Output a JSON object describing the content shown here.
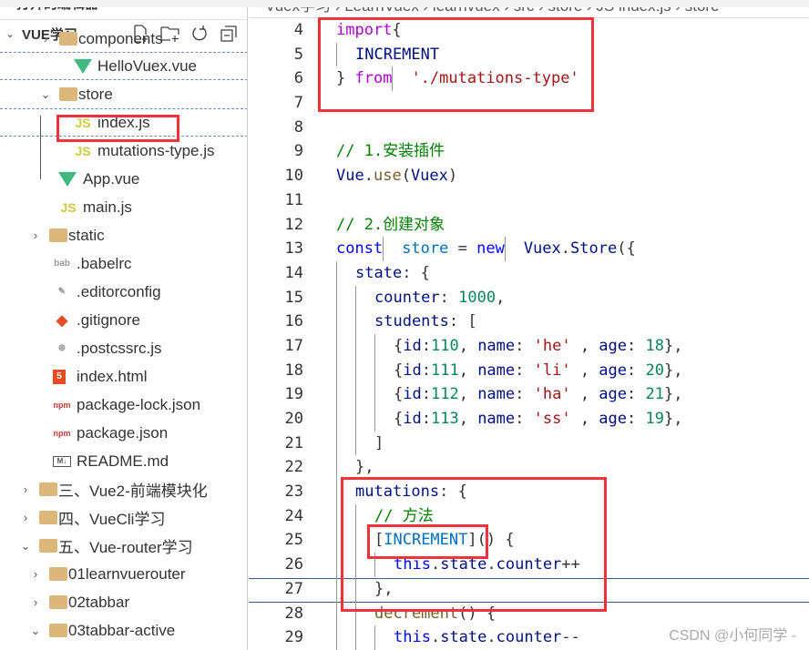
{
  "explorer": {
    "title": "打开的编辑器",
    "section": "VUE学习",
    "actions": [
      "new-file-icon",
      "new-folder-icon",
      "refresh-icon",
      "collapse-all-icon"
    ],
    "items": [
      {
        "label": "components",
        "icon": "folder",
        "depth": 3
      },
      {
        "label": "HelloVuex.vue",
        "icon": "vue",
        "depth": 4
      },
      {
        "label": "store",
        "icon": "folder",
        "depth": 3,
        "expanded": true
      },
      {
        "label": "index.js",
        "icon": "js",
        "depth": 4,
        "selected": true
      },
      {
        "label": "mutations-type.js",
        "icon": "js",
        "depth": 4
      },
      {
        "label": "App.vue",
        "icon": "vue",
        "depth": 3
      },
      {
        "label": "main.js",
        "icon": "js",
        "depth": 3
      },
      {
        "label": "static",
        "icon": "folder",
        "depth": 2,
        "expanded": false
      },
      {
        "label": ".babelrc",
        "icon": "babel",
        "depth": 2
      },
      {
        "label": ".editorconfig",
        "icon": "editorconfig",
        "depth": 2
      },
      {
        "label": ".gitignore",
        "icon": "git",
        "depth": 2
      },
      {
        "label": ".postcssrc.js",
        "icon": "postcss",
        "depth": 2
      },
      {
        "label": "index.html",
        "icon": "html",
        "depth": 2
      },
      {
        "label": "package-lock.json",
        "icon": "npm",
        "depth": 2
      },
      {
        "label": "package.json",
        "icon": "npm",
        "depth": 2
      },
      {
        "label": "README.md",
        "icon": "md",
        "depth": 2
      },
      {
        "label": "三、Vue2-前端模块化",
        "icon": "folder",
        "depth": 1,
        "expanded": false
      },
      {
        "label": "四、VueCli学习",
        "icon": "folder",
        "depth": 1,
        "expanded": false
      },
      {
        "label": "五、Vue-router学习",
        "icon": "folder",
        "depth": 1,
        "expanded": true
      },
      {
        "label": "01learnvuerouter",
        "icon": "folder",
        "depth": 2,
        "expanded": false
      },
      {
        "label": "02tabbar",
        "icon": "folder",
        "depth": 2,
        "expanded": false
      },
      {
        "label": "03tabbar-active",
        "icon": "folder",
        "depth": 2,
        "expanded": true
      }
    ]
  },
  "breadcrumb": "Vuex学习 › LearnVuex › learnvuex › src › store › JS index.js › store",
  "code": [
    {
      "n": 4,
      "t": [
        [
          "import",
          "kw"
        ],
        [
          "{",
          "pn"
        ]
      ]
    },
    {
      "n": 5,
      "t": [
        [
          "  ",
          ""
        ],
        [
          "INCREMENT",
          "id"
        ]
      ]
    },
    {
      "n": 6,
      "t": [
        [
          "} ",
          "pn"
        ],
        [
          "from",
          "kw"
        ],
        [
          " ",
          ""
        ],
        [
          "'./mutations-type'",
          "str"
        ]
      ]
    },
    {
      "n": 7,
      "t": []
    },
    {
      "n": 8,
      "t": []
    },
    {
      "n": 9,
      "t": [
        [
          "// 1.安装插件",
          "cm"
        ]
      ]
    },
    {
      "n": 10,
      "t": [
        [
          "Vue",
          "id"
        ],
        [
          ".",
          "pn"
        ],
        [
          "use",
          "fn"
        ],
        [
          "(",
          "pn"
        ],
        [
          "Vuex",
          "id"
        ],
        [
          ")",
          "pn"
        ]
      ]
    },
    {
      "n": 11,
      "t": []
    },
    {
      "n": 12,
      "t": [
        [
          "// 2.创建对象",
          "cm"
        ]
      ]
    },
    {
      "n": 13,
      "t": [
        [
          "const",
          "bl"
        ],
        [
          " ",
          ""
        ],
        [
          "store",
          "cn"
        ],
        [
          " = ",
          "pn"
        ],
        [
          "new",
          "bl"
        ],
        [
          " ",
          ""
        ],
        [
          "Vuex",
          "id"
        ],
        [
          ".",
          "pn"
        ],
        [
          "Store",
          "id"
        ],
        [
          "({",
          "pn"
        ]
      ]
    },
    {
      "n": 14,
      "t": [
        [
          "  ",
          ""
        ],
        [
          "state",
          "id"
        ],
        [
          ": {",
          "pn"
        ]
      ]
    },
    {
      "n": 15,
      "t": [
        [
          "    ",
          ""
        ],
        [
          "counter",
          "id"
        ],
        [
          ": ",
          "pn"
        ],
        [
          "1000",
          "num"
        ],
        [
          ",",
          "pn"
        ]
      ]
    },
    {
      "n": 16,
      "t": [
        [
          "    ",
          ""
        ],
        [
          "students",
          "id"
        ],
        [
          ": [",
          "pn"
        ]
      ]
    },
    {
      "n": 17,
      "t": [
        [
          "      ",
          ""
        ],
        [
          "{",
          "pn"
        ],
        [
          "id",
          "id"
        ],
        [
          ":",
          "pn"
        ],
        [
          "110",
          "num"
        ],
        [
          ", ",
          "pn"
        ],
        [
          "name",
          "id"
        ],
        [
          ": ",
          "pn"
        ],
        [
          "'he'",
          "str"
        ],
        [
          " , ",
          "pn"
        ],
        [
          "age",
          "id"
        ],
        [
          ": ",
          "pn"
        ],
        [
          "18",
          "num"
        ],
        [
          "},",
          "pn"
        ]
      ]
    },
    {
      "n": 18,
      "t": [
        [
          "      ",
          ""
        ],
        [
          "{",
          "pn"
        ],
        [
          "id",
          "id"
        ],
        [
          ":",
          "pn"
        ],
        [
          "111",
          "num"
        ],
        [
          ", ",
          "pn"
        ],
        [
          "name",
          "id"
        ],
        [
          ": ",
          "pn"
        ],
        [
          "'li'",
          "str"
        ],
        [
          " , ",
          "pn"
        ],
        [
          "age",
          "id"
        ],
        [
          ": ",
          "pn"
        ],
        [
          "20",
          "num"
        ],
        [
          "},",
          "pn"
        ]
      ]
    },
    {
      "n": 19,
      "t": [
        [
          "      ",
          ""
        ],
        [
          "{",
          "pn"
        ],
        [
          "id",
          "id"
        ],
        [
          ":",
          "pn"
        ],
        [
          "112",
          "num"
        ],
        [
          ", ",
          "pn"
        ],
        [
          "name",
          "id"
        ],
        [
          ": ",
          "pn"
        ],
        [
          "'ha'",
          "str"
        ],
        [
          " , ",
          "pn"
        ],
        [
          "age",
          "id"
        ],
        [
          ": ",
          "pn"
        ],
        [
          "21",
          "num"
        ],
        [
          "},",
          "pn"
        ]
      ]
    },
    {
      "n": 20,
      "t": [
        [
          "      ",
          ""
        ],
        [
          "{",
          "pn"
        ],
        [
          "id",
          "id"
        ],
        [
          ":",
          "pn"
        ],
        [
          "113",
          "num"
        ],
        [
          ", ",
          "pn"
        ],
        [
          "name",
          "id"
        ],
        [
          ": ",
          "pn"
        ],
        [
          "'ss'",
          "str"
        ],
        [
          " , ",
          "pn"
        ],
        [
          "age",
          "id"
        ],
        [
          ": ",
          "pn"
        ],
        [
          "19",
          "num"
        ],
        [
          "},",
          "pn"
        ]
      ]
    },
    {
      "n": 21,
      "t": [
        [
          "    ",
          ""
        ],
        [
          "]",
          "pn"
        ]
      ]
    },
    {
      "n": 22,
      "t": [
        [
          "  ",
          ""
        ],
        [
          "},",
          "pn"
        ]
      ]
    },
    {
      "n": 23,
      "t": [
        [
          "  ",
          ""
        ],
        [
          "mutations",
          "id"
        ],
        [
          ": {",
          "pn"
        ]
      ]
    },
    {
      "n": 24,
      "t": [
        [
          "    ",
          ""
        ],
        [
          "// 方法",
          "cm"
        ]
      ]
    },
    {
      "n": 25,
      "t": [
        [
          "    ",
          ""
        ],
        [
          "[",
          "pn"
        ],
        [
          "INCREMENT",
          "cn"
        ],
        [
          "]",
          "pn"
        ],
        [
          "() {",
          "pn"
        ]
      ]
    },
    {
      "n": 26,
      "t": [
        [
          "      ",
          ""
        ],
        [
          "this",
          "bl"
        ],
        [
          ".",
          "pn"
        ],
        [
          "state",
          "id"
        ],
        [
          ".",
          "pn"
        ],
        [
          "counter",
          "id"
        ],
        [
          "++",
          "pn"
        ]
      ]
    },
    {
      "n": 27,
      "t": [
        [
          "    ",
          ""
        ],
        [
          "},",
          "pn"
        ]
      ]
    },
    {
      "n": 28,
      "t": [
        [
          "    ",
          ""
        ],
        [
          "decrement",
          "fn"
        ],
        [
          "() {",
          "pn"
        ]
      ]
    },
    {
      "n": 29,
      "t": [
        [
          "      ",
          ""
        ],
        [
          "this",
          "bl"
        ],
        [
          ".",
          "pn"
        ],
        [
          "state",
          "id"
        ],
        [
          ".",
          "pn"
        ],
        [
          "counter",
          "id"
        ],
        [
          "--",
          "pn"
        ]
      ]
    }
  ],
  "watermark": "CSDN @小何同学 -",
  "colors": {
    "highlight_box": "#f0333a",
    "keyword": "#af00db",
    "string": "#a31515",
    "number": "#098658",
    "comment": "#008000"
  }
}
